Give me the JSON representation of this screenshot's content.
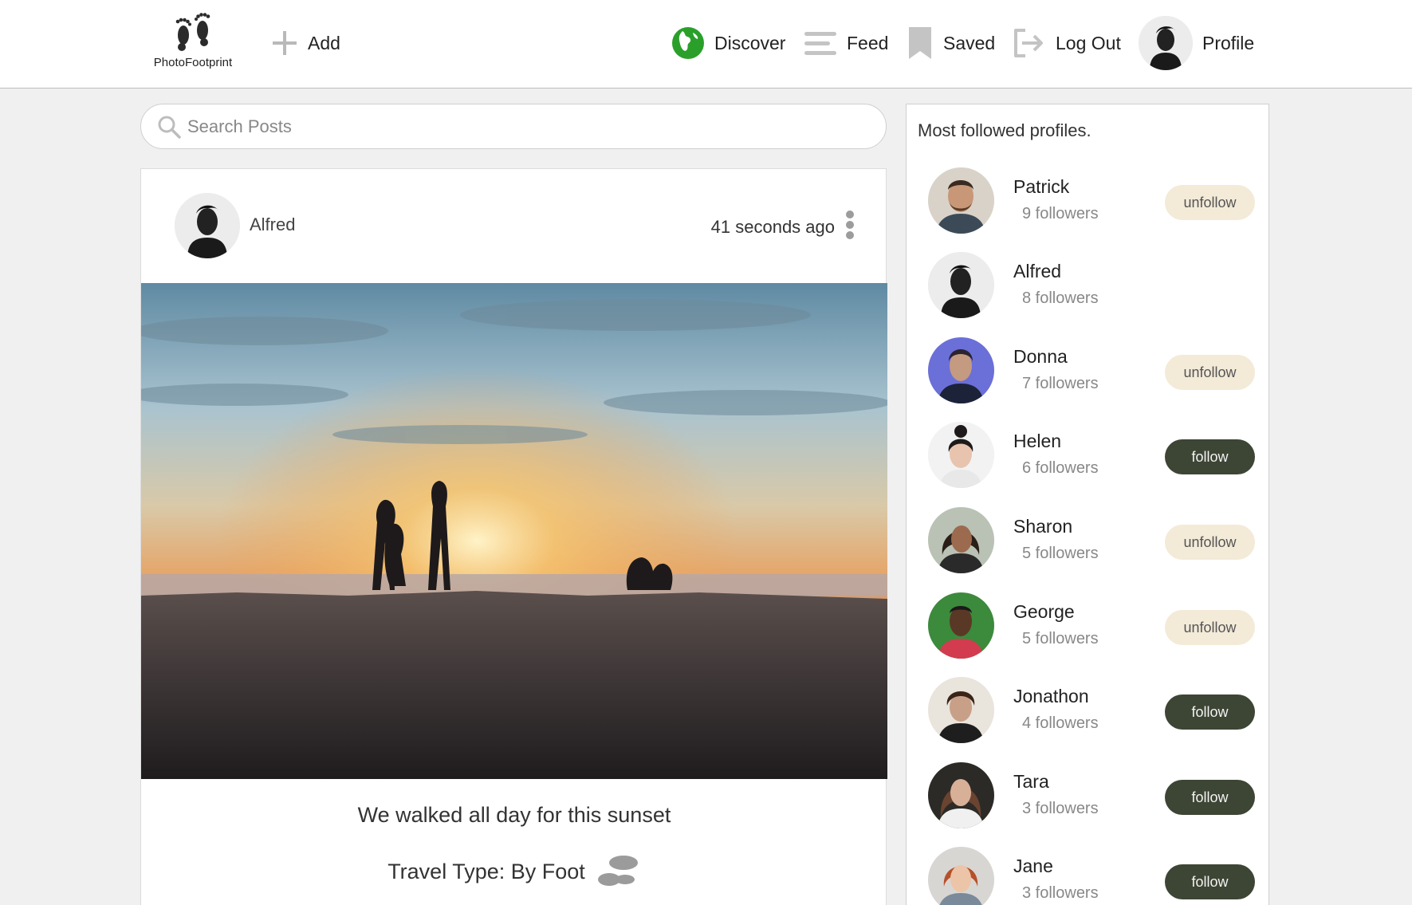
{
  "app": {
    "logo_text": "PhotoFootprint",
    "add_label": "Add"
  },
  "nav": {
    "discover": "Discover",
    "feed": "Feed",
    "saved": "Saved",
    "logout": "Log Out",
    "profile": "Profile"
  },
  "search": {
    "placeholder": "Search Posts",
    "value": ""
  },
  "post": {
    "author": "Alfred",
    "time": "41 seconds ago",
    "caption": "We walked all day for this sunset",
    "travel_type": "Travel Type: By Foot"
  },
  "side": {
    "title": "Most followed profiles.",
    "profiles": [
      {
        "name": "Patrick",
        "followers": "9 followers",
        "action": "unfollow"
      },
      {
        "name": "Alfred",
        "followers": "8 followers",
        "action": ""
      },
      {
        "name": "Donna",
        "followers": "7 followers",
        "action": "unfollow"
      },
      {
        "name": "Helen",
        "followers": "6 followers",
        "action": "follow"
      },
      {
        "name": "Sharon",
        "followers": "5 followers",
        "action": "unfollow"
      },
      {
        "name": "George",
        "followers": "5 followers",
        "action": "unfollow"
      },
      {
        "name": "Jonathon",
        "followers": "4 followers",
        "action": "follow"
      },
      {
        "name": "Tara",
        "followers": "3 followers",
        "action": "follow"
      },
      {
        "name": "Jane",
        "followers": "3 followers",
        "action": "follow"
      }
    ]
  },
  "colors": {
    "follow_bg": "#3d4535",
    "unfollow_bg": "#f3ead8",
    "discover_green": "#2aa02a"
  }
}
